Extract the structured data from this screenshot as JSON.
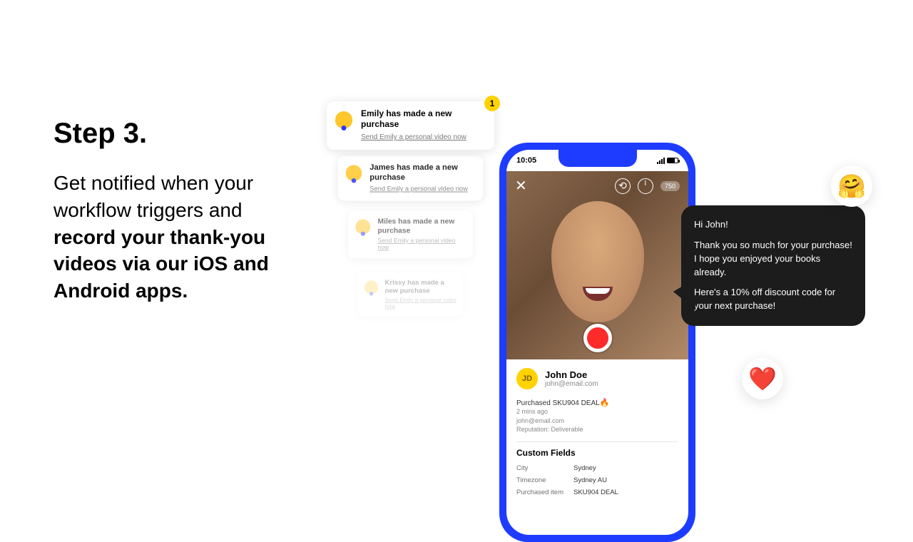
{
  "left": {
    "title": "Step 3.",
    "desc_plain": "Get notified when your workflow triggers and ",
    "desc_bold": "record your thank-you videos via our iOS and Android apps."
  },
  "notifications": {
    "badge": "1",
    "items": [
      {
        "title": "Emily has made a new purchase",
        "link": "Send Emily a personal video now"
      },
      {
        "title": "James has made a new purchase",
        "link": "Send Emily a personal video now"
      },
      {
        "title": "Miles has made a new purchase",
        "link": "Send Emily a personal video now"
      },
      {
        "title": "Krissy has made a new purchase",
        "link": "Send Emily a personal video now"
      }
    ]
  },
  "phone": {
    "time": "10:05",
    "speed_pill": "750",
    "user": {
      "initials": "JD",
      "name": "John Doe",
      "email": "john@email.com"
    },
    "purchase_line": "Purchased SKU904 DEAL",
    "fire_icon": "🔥",
    "meta": {
      "ago": "2 mins ago",
      "email": "john@email.com",
      "reputation": "Reputation: Deliverable"
    },
    "custom_fields_title": "Custom Fields",
    "fields": [
      {
        "k": "City",
        "v": "Sydney"
      },
      {
        "k": "Timezone",
        "v": "Sydney AU"
      },
      {
        "k": "Purchased item",
        "v": "SKU904 DEAL"
      }
    ]
  },
  "bubble": {
    "line1": "Hi John!",
    "line2": "Thank you so much for your purchase! I hope you enjoyed your books already.",
    "line3": "Here's a 10% off discount code for your next purchase!"
  },
  "emojis": {
    "hug": "🤗",
    "heart": "❤️"
  }
}
